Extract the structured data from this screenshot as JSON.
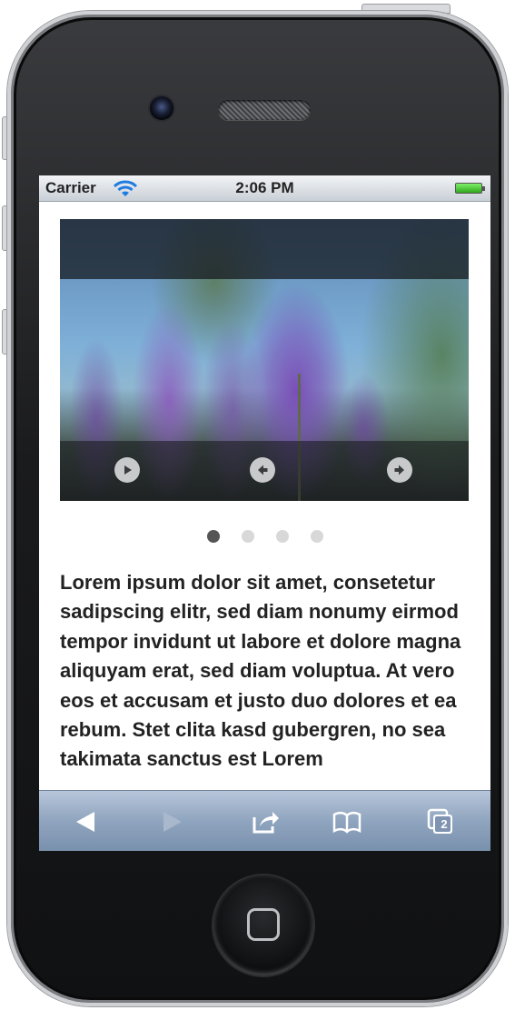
{
  "status_bar": {
    "carrier": "Carrier",
    "time": "2:06 PM",
    "wifi_icon": "wifi-icon",
    "battery_icon": "battery-icon"
  },
  "gallery": {
    "image": "lavender-flower-photo",
    "controls": [
      {
        "icon": "play-icon"
      },
      {
        "icon": "arrow-left-icon"
      },
      {
        "icon": "arrow-right-icon"
      }
    ]
  },
  "pagination": {
    "count": 4,
    "active_index": 0
  },
  "content": {
    "text": "Lorem ipsum dolor sit amet, consetetur sadipscing elitr, sed diam nonumy eirmod tempor invidunt ut labore et dolore magna aliquyam erat, sed diam voluptua. At vero eos et accusam et justo duo dolores et ea rebum. Stet clita kasd gubergren, no sea takimata sanctus est Lorem"
  },
  "toolbar": {
    "back_icon": "back-arrow-icon",
    "forward_icon": "forward-arrow-icon",
    "share_icon": "share-icon",
    "bookmarks_icon": "bookmarks-book-icon",
    "tabs_icon": "tabs-icon",
    "tabs_count": "2"
  },
  "colors": {
    "toolbar": "#8fa4be",
    "active_dot": "#555555",
    "inactive_dot": "#d8d8d8"
  }
}
